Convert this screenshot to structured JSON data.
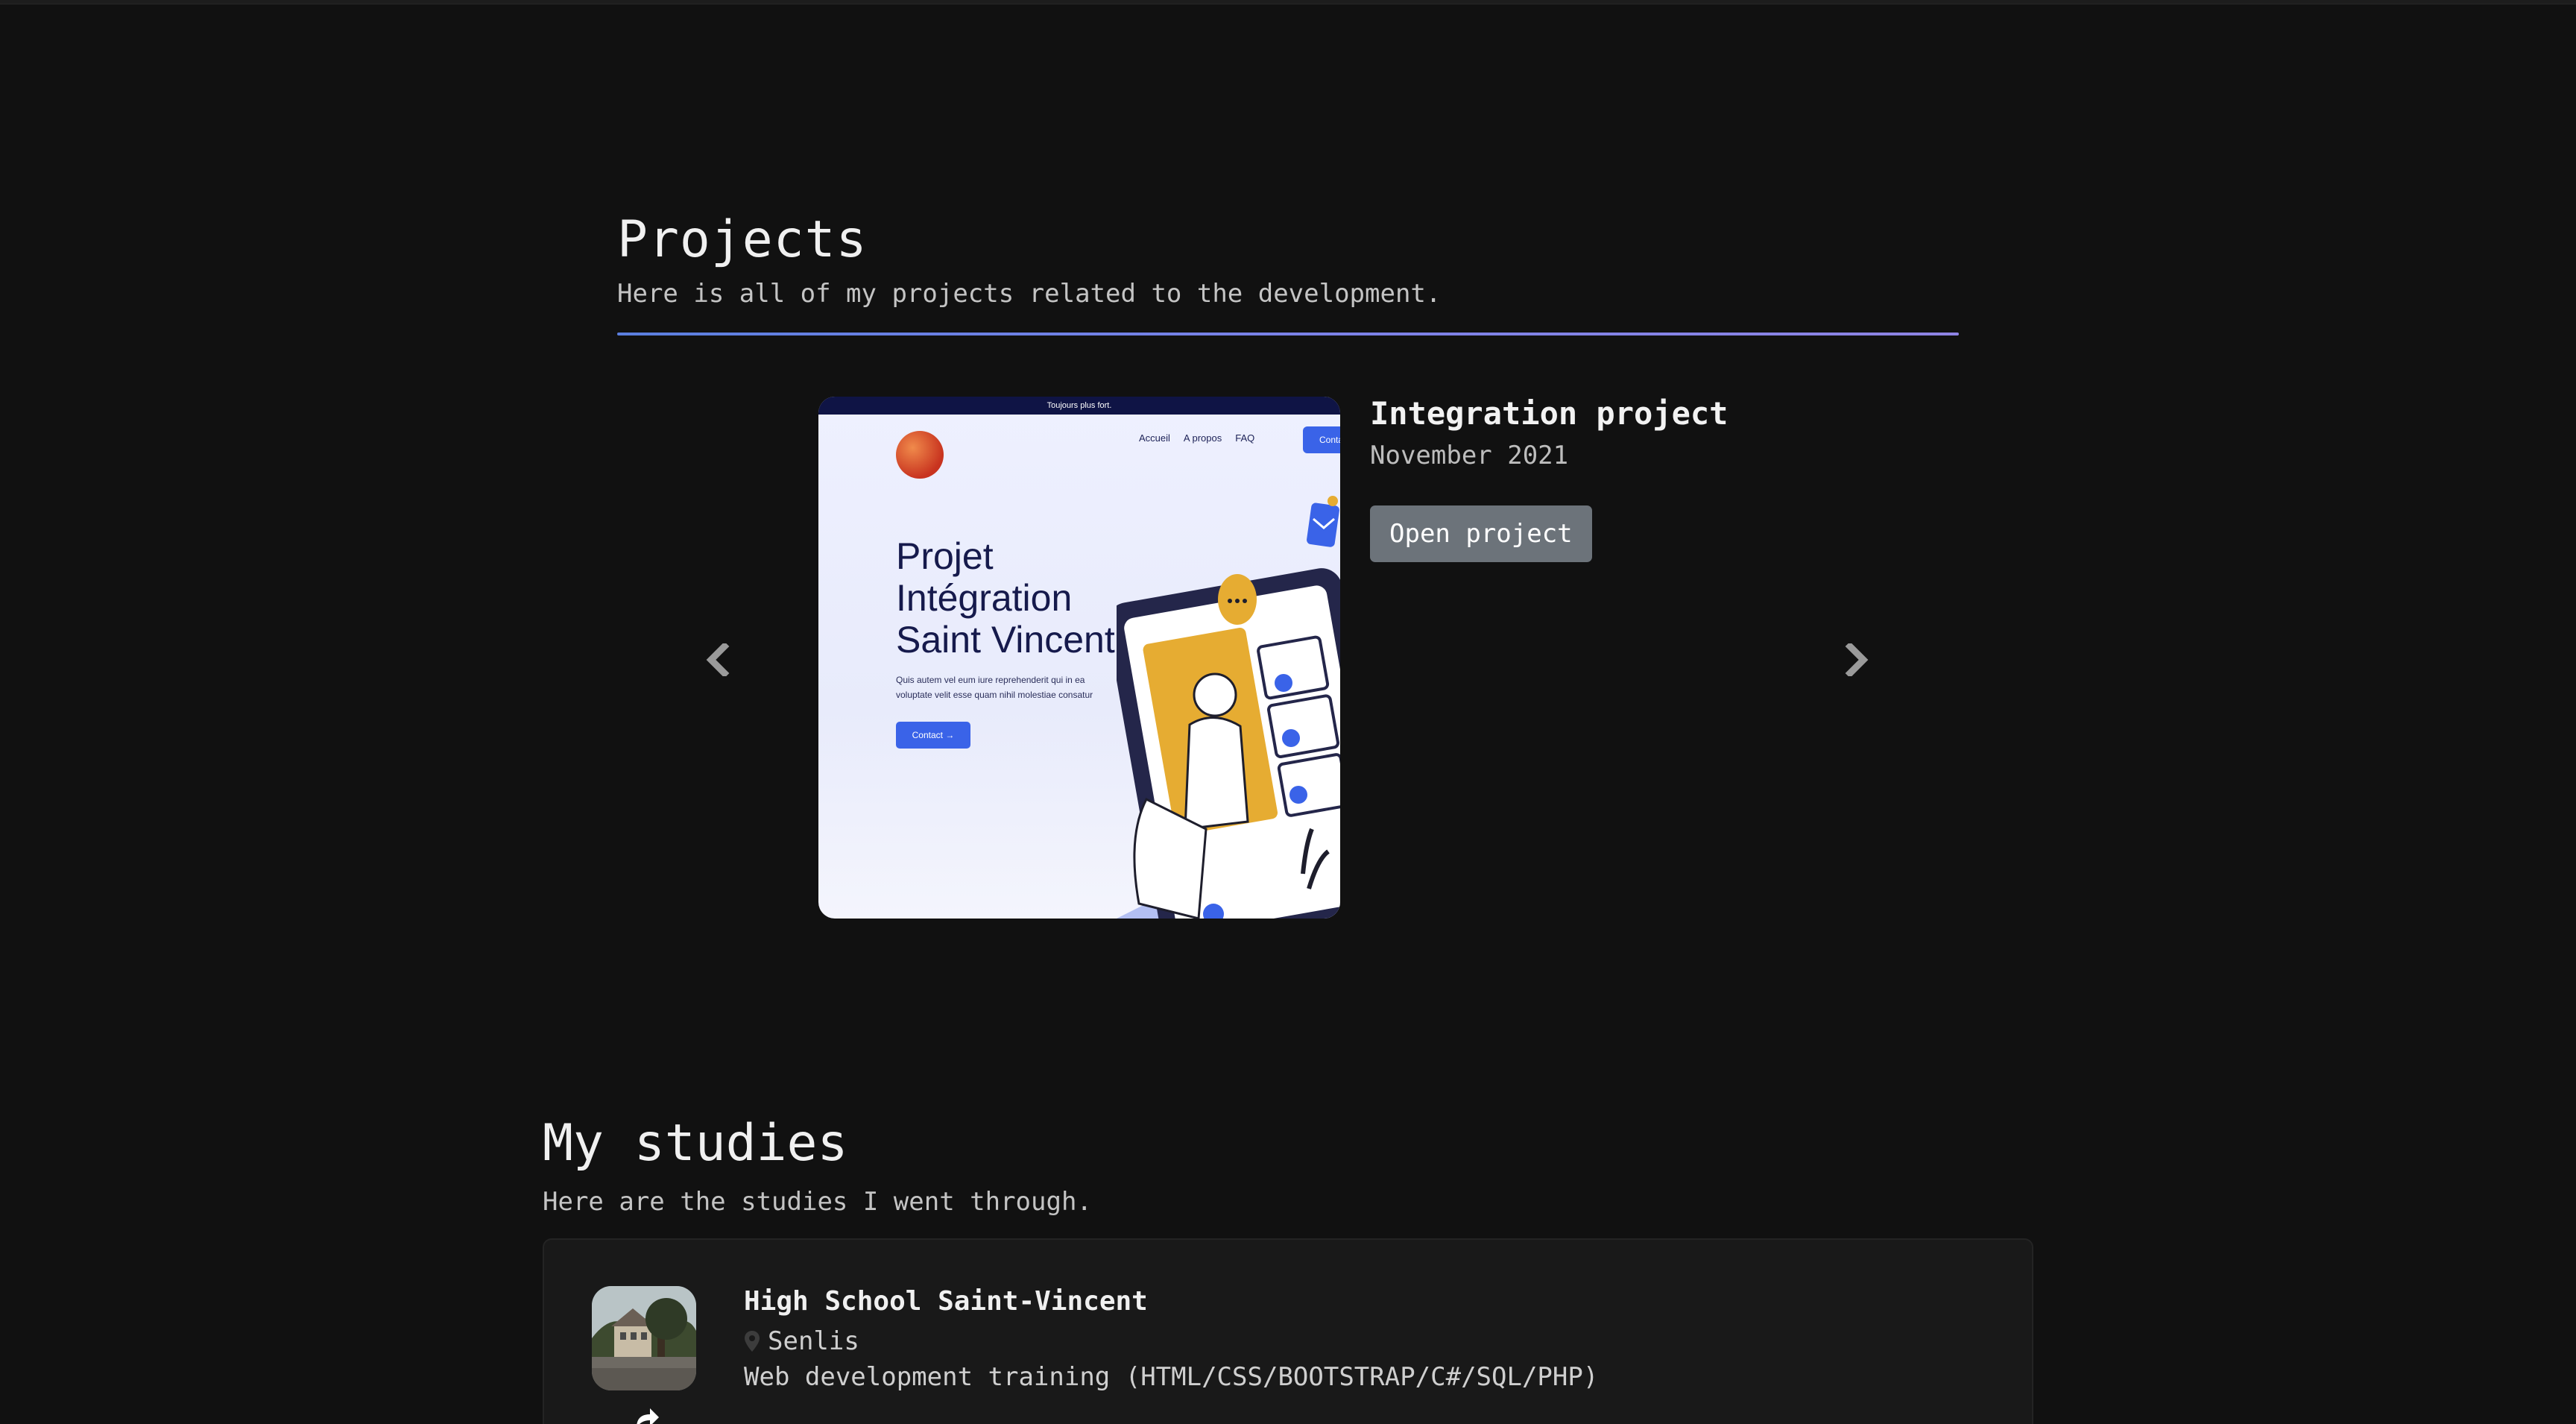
{
  "projects": {
    "title": "Projects",
    "subtitle": "Here is all of my projects related to the development.",
    "accent_gradient": [
      "#5b7fe0",
      "#8e84e4"
    ],
    "carousel": {
      "prev_icon": "chevron-left-icon",
      "next_icon": "chevron-right-icon",
      "current_slide": {
        "title": "Integration project",
        "date": "November 2021",
        "button_label": "Open project",
        "screenshot": {
          "topbar_text": "Toujours plus fort.",
          "nav": [
            "Accueil",
            "A propos",
            "FAQ"
          ],
          "nav_button": "Contact",
          "hero_lines": [
            "Projet",
            "Intégration",
            "Saint Vincent"
          ],
          "hero_text": "Quis autem vel eum iure reprehenderit qui in ea voluptate velit esse quam nihil molestiae consatur",
          "cta_label": "Contact →"
        }
      }
    }
  },
  "studies": {
    "title": "My studies",
    "subtitle": "Here are the studies I went through.",
    "items": [
      {
        "name": "High School Saint-Vincent",
        "location": "Senlis",
        "description": "Web development training (HTML/CSS/BOOTSTRAP/C#/SQL/PHP)",
        "location_icon": "map-pin-icon",
        "link_icon": "share-arrow-icon"
      }
    ]
  },
  "colors": {
    "background": "#111111",
    "card": "#191919",
    "button": "#6c737a"
  }
}
